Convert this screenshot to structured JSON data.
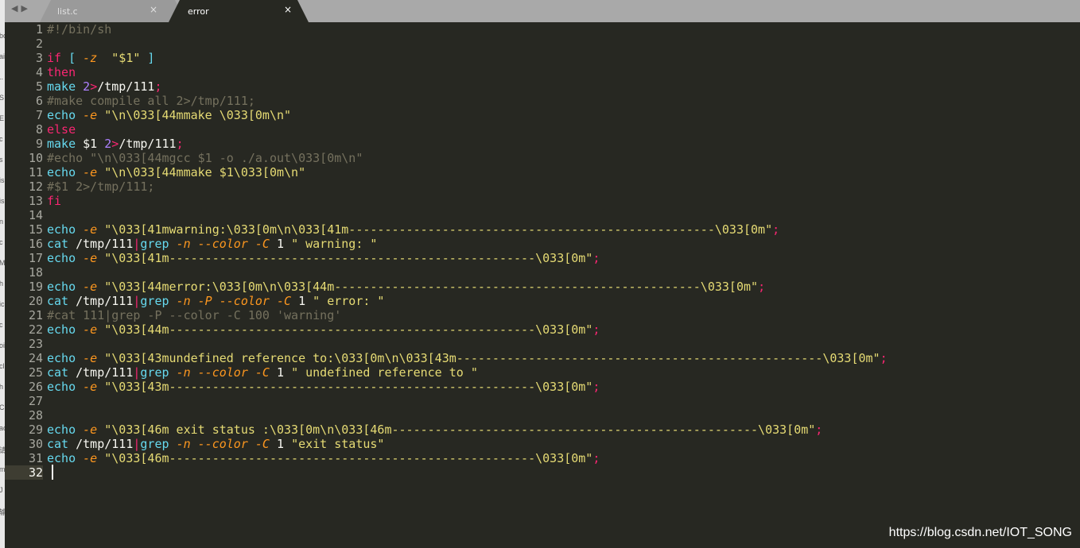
{
  "left_strip": {
    "fragments": [
      "bc",
      "ai",
      "..",
      "S",
      "E",
      "c",
      "s",
      "is",
      "is",
      "n",
      "c",
      "M",
      "h",
      "ic",
      "c",
      "oi",
      "cl",
      "h",
      "C",
      "ac",
      "请",
      "m",
      "J",
      "输"
    ]
  },
  "tabs": [
    {
      "label": "list.c",
      "close": "×"
    },
    {
      "label": "error",
      "close": "×"
    }
  ],
  "nav_arrows": "◀▶",
  "editor": {
    "lines": [
      {
        "n": "1",
        "tokens": [
          {
            "t": "#!/bin/sh",
            "c": "comment"
          }
        ]
      },
      {
        "n": "2",
        "tokens": []
      },
      {
        "n": "3",
        "tokens": [
          {
            "t": "if",
            "c": "keyword"
          },
          {
            "t": " [ ",
            "c": "cmd"
          },
          {
            "t": "-z",
            "c": "italic"
          },
          {
            "t": "  ",
            "c": "plain"
          },
          {
            "t": "\"$1\"",
            "c": "string"
          },
          {
            "t": " ]",
            "c": "cmd"
          }
        ]
      },
      {
        "n": "4",
        "tokens": [
          {
            "t": "then",
            "c": "keyword"
          }
        ]
      },
      {
        "n": "5",
        "tokens": [
          {
            "t": "make ",
            "c": "cmd"
          },
          {
            "t": "2",
            "c": "number"
          },
          {
            "t": ">",
            "c": "op"
          },
          {
            "t": "/tmp/111",
            "c": "plain"
          },
          {
            "t": ";",
            "c": "op"
          }
        ]
      },
      {
        "n": "6",
        "tokens": [
          {
            "t": "#make compile all 2>/tmp/111;",
            "c": "comment"
          }
        ]
      },
      {
        "n": "7",
        "tokens": [
          {
            "t": "echo ",
            "c": "cmd"
          },
          {
            "t": "-e",
            "c": "italic"
          },
          {
            "t": " ",
            "c": "plain"
          },
          {
            "t": "\"\\n\\033[44mmake \\033[0m\\n\"",
            "c": "string"
          }
        ]
      },
      {
        "n": "8",
        "tokens": [
          {
            "t": "else",
            "c": "keyword"
          }
        ]
      },
      {
        "n": "9",
        "tokens": [
          {
            "t": "make ",
            "c": "cmd"
          },
          {
            "t": "$1 ",
            "c": "plain"
          },
          {
            "t": "2",
            "c": "number"
          },
          {
            "t": ">",
            "c": "op"
          },
          {
            "t": "/tmp/111",
            "c": "plain"
          },
          {
            "t": ";",
            "c": "op"
          }
        ]
      },
      {
        "n": "10",
        "tokens": [
          {
            "t": "#echo \"\\n\\033[44mgcc $1 -o ./a.out\\033[0m\\n\"",
            "c": "comment"
          }
        ]
      },
      {
        "n": "11",
        "tokens": [
          {
            "t": "echo ",
            "c": "cmd"
          },
          {
            "t": "-e",
            "c": "italic"
          },
          {
            "t": " ",
            "c": "plain"
          },
          {
            "t": "\"\\n\\033[44mmake $1\\033[0m\\n\"",
            "c": "string"
          }
        ]
      },
      {
        "n": "12",
        "tokens": [
          {
            "t": "#$1 2>/tmp/111;",
            "c": "comment"
          }
        ]
      },
      {
        "n": "13",
        "tokens": [
          {
            "t": "fi",
            "c": "keyword"
          }
        ]
      },
      {
        "n": "14",
        "tokens": []
      },
      {
        "n": "15",
        "tokens": [
          {
            "t": "echo ",
            "c": "cmd"
          },
          {
            "t": "-e",
            "c": "italic"
          },
          {
            "t": " ",
            "c": "plain"
          },
          {
            "t": "\"\\033[41mwarning:\\033[0m\\n\\033[41m---------------------------------------------------\\033[0m\"",
            "c": "string"
          },
          {
            "t": ";",
            "c": "op"
          }
        ]
      },
      {
        "n": "16",
        "tokens": [
          {
            "t": "cat ",
            "c": "cmd"
          },
          {
            "t": "/tmp/111",
            "c": "plain"
          },
          {
            "t": "|",
            "c": "op"
          },
          {
            "t": "grep ",
            "c": "cmd"
          },
          {
            "t": "-n",
            "c": "italic"
          },
          {
            "t": " ",
            "c": "plain"
          },
          {
            "t": "--color",
            "c": "italic"
          },
          {
            "t": " ",
            "c": "plain"
          },
          {
            "t": "-C",
            "c": "italic"
          },
          {
            "t": " 1 ",
            "c": "plain"
          },
          {
            "t": "\" warning: \"",
            "c": "string"
          }
        ]
      },
      {
        "n": "17",
        "tokens": [
          {
            "t": "echo ",
            "c": "cmd"
          },
          {
            "t": "-e",
            "c": "italic"
          },
          {
            "t": " ",
            "c": "plain"
          },
          {
            "t": "\"\\033[41m---------------------------------------------------\\033[0m\"",
            "c": "string"
          },
          {
            "t": ";",
            "c": "op"
          }
        ]
      },
      {
        "n": "18",
        "tokens": []
      },
      {
        "n": "19",
        "tokens": [
          {
            "t": "echo ",
            "c": "cmd"
          },
          {
            "t": "-e",
            "c": "italic"
          },
          {
            "t": " ",
            "c": "plain"
          },
          {
            "t": "\"\\033[44merror:\\033[0m\\n\\033[44m---------------------------------------------------\\033[0m\"",
            "c": "string"
          },
          {
            "t": ";",
            "c": "op"
          }
        ]
      },
      {
        "n": "20",
        "tokens": [
          {
            "t": "cat ",
            "c": "cmd"
          },
          {
            "t": "/tmp/111",
            "c": "plain"
          },
          {
            "t": "|",
            "c": "op"
          },
          {
            "t": "grep ",
            "c": "cmd"
          },
          {
            "t": "-n",
            "c": "italic"
          },
          {
            "t": " ",
            "c": "plain"
          },
          {
            "t": "-P",
            "c": "italic"
          },
          {
            "t": " ",
            "c": "plain"
          },
          {
            "t": "--color",
            "c": "italic"
          },
          {
            "t": " ",
            "c": "plain"
          },
          {
            "t": "-C",
            "c": "italic"
          },
          {
            "t": " 1 ",
            "c": "plain"
          },
          {
            "t": "\" error: \"",
            "c": "string"
          }
        ]
      },
      {
        "n": "21",
        "tokens": [
          {
            "t": "#cat 111|grep -P --color -C 100 'warning'",
            "c": "comment"
          }
        ]
      },
      {
        "n": "22",
        "tokens": [
          {
            "t": "echo ",
            "c": "cmd"
          },
          {
            "t": "-e",
            "c": "italic"
          },
          {
            "t": " ",
            "c": "plain"
          },
          {
            "t": "\"\\033[44m---------------------------------------------------\\033[0m\"",
            "c": "string"
          },
          {
            "t": ";",
            "c": "op"
          }
        ]
      },
      {
        "n": "23",
        "tokens": []
      },
      {
        "n": "24",
        "tokens": [
          {
            "t": "echo ",
            "c": "cmd"
          },
          {
            "t": "-e",
            "c": "italic"
          },
          {
            "t": " ",
            "c": "plain"
          },
          {
            "t": "\"\\033[43mundefined reference to:\\033[0m\\n\\033[43m---------------------------------------------------\\033[0m\"",
            "c": "string"
          },
          {
            "t": ";",
            "c": "op"
          }
        ]
      },
      {
        "n": "25",
        "tokens": [
          {
            "t": "cat ",
            "c": "cmd"
          },
          {
            "t": "/tmp/111",
            "c": "plain"
          },
          {
            "t": "|",
            "c": "op"
          },
          {
            "t": "grep ",
            "c": "cmd"
          },
          {
            "t": "-n",
            "c": "italic"
          },
          {
            "t": " ",
            "c": "plain"
          },
          {
            "t": "--color",
            "c": "italic"
          },
          {
            "t": " ",
            "c": "plain"
          },
          {
            "t": "-C",
            "c": "italic"
          },
          {
            "t": " 1 ",
            "c": "plain"
          },
          {
            "t": "\" undefined reference to \"",
            "c": "string"
          }
        ]
      },
      {
        "n": "26",
        "tokens": [
          {
            "t": "echo ",
            "c": "cmd"
          },
          {
            "t": "-e",
            "c": "italic"
          },
          {
            "t": " ",
            "c": "plain"
          },
          {
            "t": "\"\\033[43m---------------------------------------------------\\033[0m\"",
            "c": "string"
          },
          {
            "t": ";",
            "c": "op"
          }
        ]
      },
      {
        "n": "27",
        "tokens": []
      },
      {
        "n": "28",
        "tokens": []
      },
      {
        "n": "29",
        "tokens": [
          {
            "t": "echo ",
            "c": "cmd"
          },
          {
            "t": "-e",
            "c": "italic"
          },
          {
            "t": " ",
            "c": "plain"
          },
          {
            "t": "\"\\033[46m exit status :\\033[0m\\n\\033[46m---------------------------------------------------\\033[0m\"",
            "c": "string"
          },
          {
            "t": ";",
            "c": "op"
          }
        ]
      },
      {
        "n": "30",
        "tokens": [
          {
            "t": "cat ",
            "c": "cmd"
          },
          {
            "t": "/tmp/111",
            "c": "plain"
          },
          {
            "t": "|",
            "c": "op"
          },
          {
            "t": "grep ",
            "c": "cmd"
          },
          {
            "t": "-n",
            "c": "italic"
          },
          {
            "t": " ",
            "c": "plain"
          },
          {
            "t": "--color",
            "c": "italic"
          },
          {
            "t": " ",
            "c": "plain"
          },
          {
            "t": "-C",
            "c": "italic"
          },
          {
            "t": " 1 ",
            "c": "plain"
          },
          {
            "t": "\"exit status\"",
            "c": "string"
          }
        ]
      },
      {
        "n": "31",
        "tokens": [
          {
            "t": "echo ",
            "c": "cmd"
          },
          {
            "t": "-e",
            "c": "italic"
          },
          {
            "t": " ",
            "c": "plain"
          },
          {
            "t": "\"\\033[46m---------------------------------------------------\\033[0m\"",
            "c": "string"
          },
          {
            "t": ";",
            "c": "op"
          }
        ]
      },
      {
        "n": "32",
        "tokens": []
      }
    ],
    "current_line": "32"
  },
  "watermark": "https://blog.csdn.net/IOT_SONG",
  "colors": {
    "background": "#272822",
    "comment": "#75715e",
    "keyword": "#f92672",
    "command": "#66d9ef",
    "flag": "#fd971f",
    "string": "#e6db74",
    "number": "#ae81ff"
  }
}
